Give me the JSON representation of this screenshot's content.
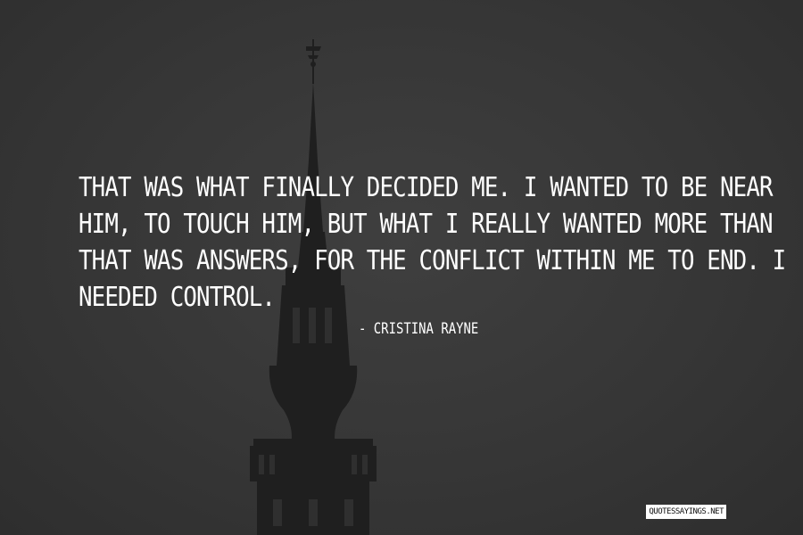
{
  "quote": {
    "lines": [
      "THAT WAS WHAT FINALLY DECIDED ME. I WANTED TO BE NEAR",
      "HIM, TO TOUCH HIM, BUT WHAT I REALLY WANTED MORE THAN",
      "THAT WAS ANSWERS, FOR THE CONFLICT WITHIN ME TO END. I",
      "NEEDED CONTROL."
    ]
  },
  "author": "- CRISTINA RAYNE",
  "watermark": "QUOTESSAYINGS.NET",
  "colors": {
    "background": "#353535",
    "text": "#ffffff",
    "silhouette": "#1e1e1e"
  }
}
